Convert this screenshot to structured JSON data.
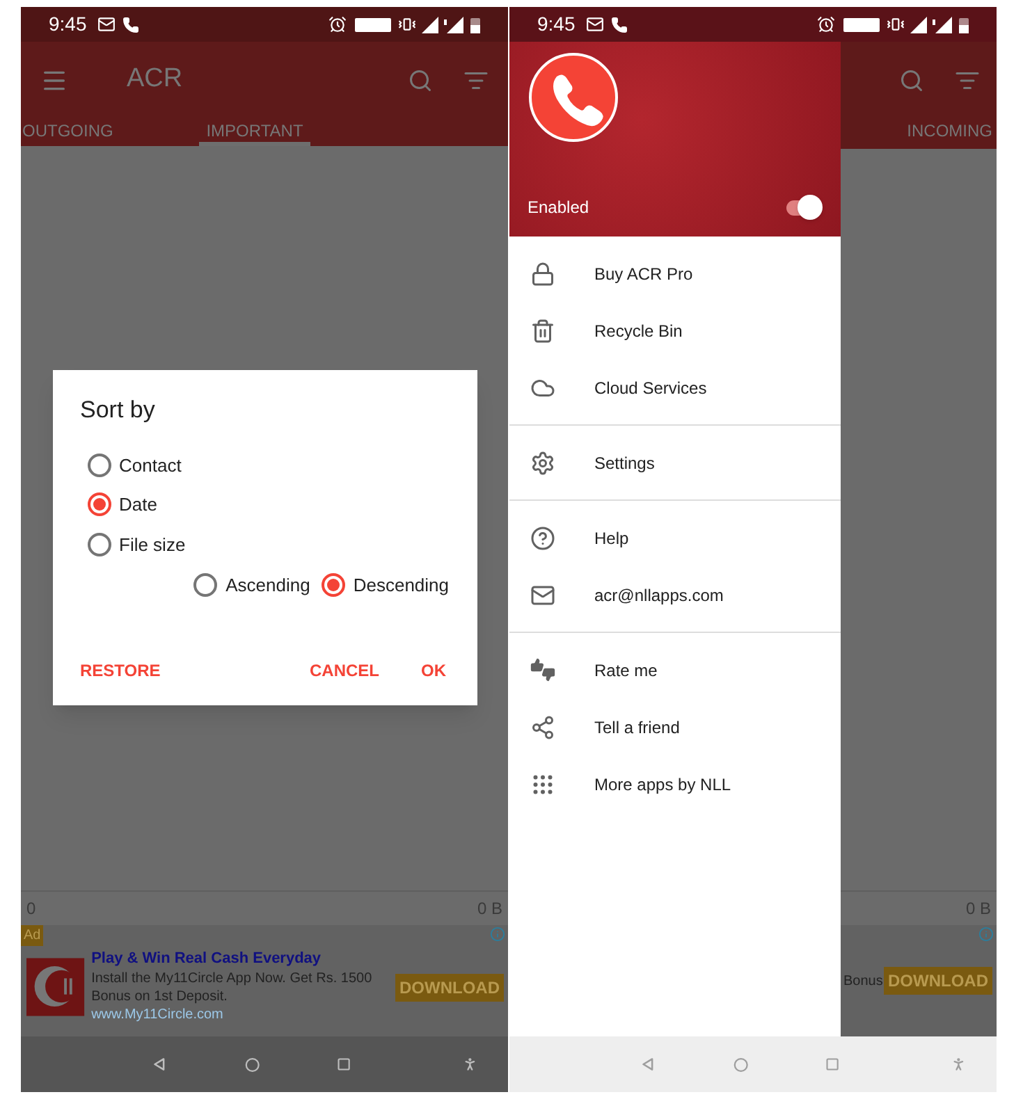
{
  "left_screen": {
    "status_bar": {
      "time": "9:45"
    },
    "app_bar": {
      "title": "ACR"
    },
    "tabs": [
      {
        "label": "OUTGOING",
        "selected": false
      },
      {
        "label": "IMPORTANT",
        "selected": true
      }
    ],
    "footer": {
      "count": "0",
      "size": "0 B"
    },
    "ad": {
      "badge": "Ad",
      "title": "Play & Win Real Cash Everyday",
      "body": "Install the My11Circle App Now. Get Rs. 1500 Bonus on 1st Deposit.",
      "url": "www.My11Circle.com",
      "button": "DOWNLOAD"
    },
    "dialog": {
      "title": "Sort by",
      "sort_options": [
        {
          "label": "Contact",
          "selected": false
        },
        {
          "label": "Date",
          "selected": true
        },
        {
          "label": "File size",
          "selected": false
        }
      ],
      "order_options": [
        {
          "label": "Ascending",
          "selected": false
        },
        {
          "label": "Descending",
          "selected": true
        }
      ],
      "buttons": {
        "restore": "RESTORE",
        "cancel": "CANCEL",
        "ok": "OK"
      }
    }
  },
  "right_screen": {
    "status_bar": {
      "time": "9:45"
    },
    "drawer": {
      "enabled": {
        "label": "Enabled",
        "on": true
      },
      "sections": [
        [
          {
            "label": "Buy ACR Pro"
          },
          {
            "label": "Recycle Bin"
          },
          {
            "label": "Cloud Services"
          }
        ],
        [
          {
            "label": "Settings"
          }
        ],
        [
          {
            "label": "Help"
          },
          {
            "label": "acr@nllapps.com"
          }
        ],
        [
          {
            "label": "Rate me"
          },
          {
            "label": "Tell a friend"
          },
          {
            "label": "More apps by NLL"
          }
        ]
      ]
    },
    "tabs": [
      {
        "label": "INCOMING",
        "selected": false
      }
    ],
    "footer": {
      "size": "0 B"
    },
    "ad": {
      "body": "Bonus",
      "button": "DOWNLOAD"
    }
  }
}
